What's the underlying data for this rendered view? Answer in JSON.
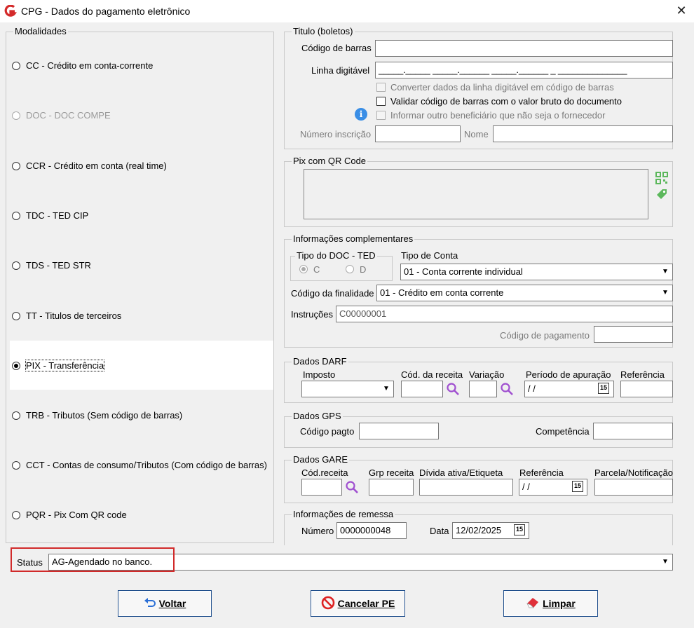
{
  "window": {
    "title": "CPG - Dados do pagamento eletrônico",
    "close_glyph": "✕"
  },
  "modalidades": {
    "legend": "Modalidades",
    "items": [
      {
        "code": "CC",
        "label": "CC  - Crédito em conta-corrente",
        "enabled": true,
        "selected": false
      },
      {
        "code": "DOC",
        "label": "DOC - DOC COMPE",
        "enabled": false,
        "selected": false
      },
      {
        "code": "CCR",
        "label": "CCR - Crédito em conta (real time)",
        "enabled": true,
        "selected": false
      },
      {
        "code": "TDC",
        "label": "TDC - TED CIP",
        "enabled": true,
        "selected": false
      },
      {
        "code": "TDS",
        "label": "TDS - TED STR",
        "enabled": true,
        "selected": false
      },
      {
        "code": "TT",
        "label": "TT  - Titulos de terceiros",
        "enabled": true,
        "selected": false
      },
      {
        "code": "PIX",
        "label": "PIX - Transferência",
        "enabled": true,
        "selected": true
      },
      {
        "code": "TRB",
        "label": "TRB - Tributos (Sem código de barras)",
        "enabled": true,
        "selected": false
      },
      {
        "code": "CCT",
        "label": "CCT - Contas de consumo/Tributos (Com código de barras)",
        "enabled": true,
        "selected": false
      },
      {
        "code": "PQR",
        "label": "PQR - Pix Com QR code",
        "enabled": true,
        "selected": false
      }
    ]
  },
  "titulo": {
    "legend": "Titulo (boletos)",
    "codigo_barras_label": "Código de barras",
    "codigo_barras_value": "",
    "linha_digitavel_label": "Linha digitável",
    "linha_digitavel_value": "_____._____ _____.______ _____.______ _ ______________",
    "chk_converter": "Converter dados da linha digitável em código de barras",
    "chk_validar": "Validar código de barras com o valor bruto do documento",
    "chk_informar": "Informar outro beneficiário que não seja o fornecedor",
    "numero_inscricao_label": "Número inscrição",
    "nome_label": "Nome"
  },
  "pix_qr": {
    "legend": "Pix com QR Code",
    "qr_icon": "qr-code-icon",
    "tag_icon": "tag-icon"
  },
  "info_compl": {
    "legend": "Informações complementares",
    "tipo_doc_legend": "Tipo do DOC - TED",
    "radio_c": "C",
    "radio_d": "D",
    "tipo_conta_label": "Tipo de Conta",
    "tipo_conta_value": "01 - Conta corrente individual",
    "codigo_finalidade_label": "Código da finalidade",
    "codigo_finalidade_value": "01 - Crédito em conta corrente",
    "instrucoes_label": "Instruções",
    "instrucoes_value": "C00000001",
    "codigo_pagamento_label": "Código de pagamento"
  },
  "darf": {
    "legend": "Dados DARF",
    "imposto_label": "Imposto",
    "cod_receita_label": "Cód. da receita",
    "variacao_label": "Variação",
    "periodo_label": "Período de apuração",
    "periodo_value": " / /",
    "referencia_label": "Referência"
  },
  "gps": {
    "legend": "Dados GPS",
    "codigo_pagto_label": "Código pagto",
    "competencia_label": "Competência"
  },
  "gare": {
    "legend": "Dados GARE",
    "cod_receita_label": "Cód.receita",
    "grp_receita_label": "Grp receita",
    "divida_label": "Dívida ativa/Etiqueta",
    "referencia_label": "Referência",
    "referencia_value": " / /",
    "parcela_label": "Parcela/Notificação"
  },
  "remessa": {
    "legend": "Informações de remessa",
    "numero_label": "Número",
    "numero_value": "0000000048",
    "data_label": "Data",
    "data_value": "12/02/2025"
  },
  "status": {
    "label": "Status",
    "value": "AG-Agendado no banco."
  },
  "buttons": {
    "voltar": "Voltar",
    "cancelar": "Cancelar PE",
    "limpar": "Limpar"
  },
  "calendar_glyph": "15",
  "combo_glyph": "▼",
  "colors": {
    "highlight_border": "#d12a2a",
    "info_icon": "#3a8ee6",
    "search_icon": "#a050d0",
    "qr_icon": "#5cb85c"
  }
}
